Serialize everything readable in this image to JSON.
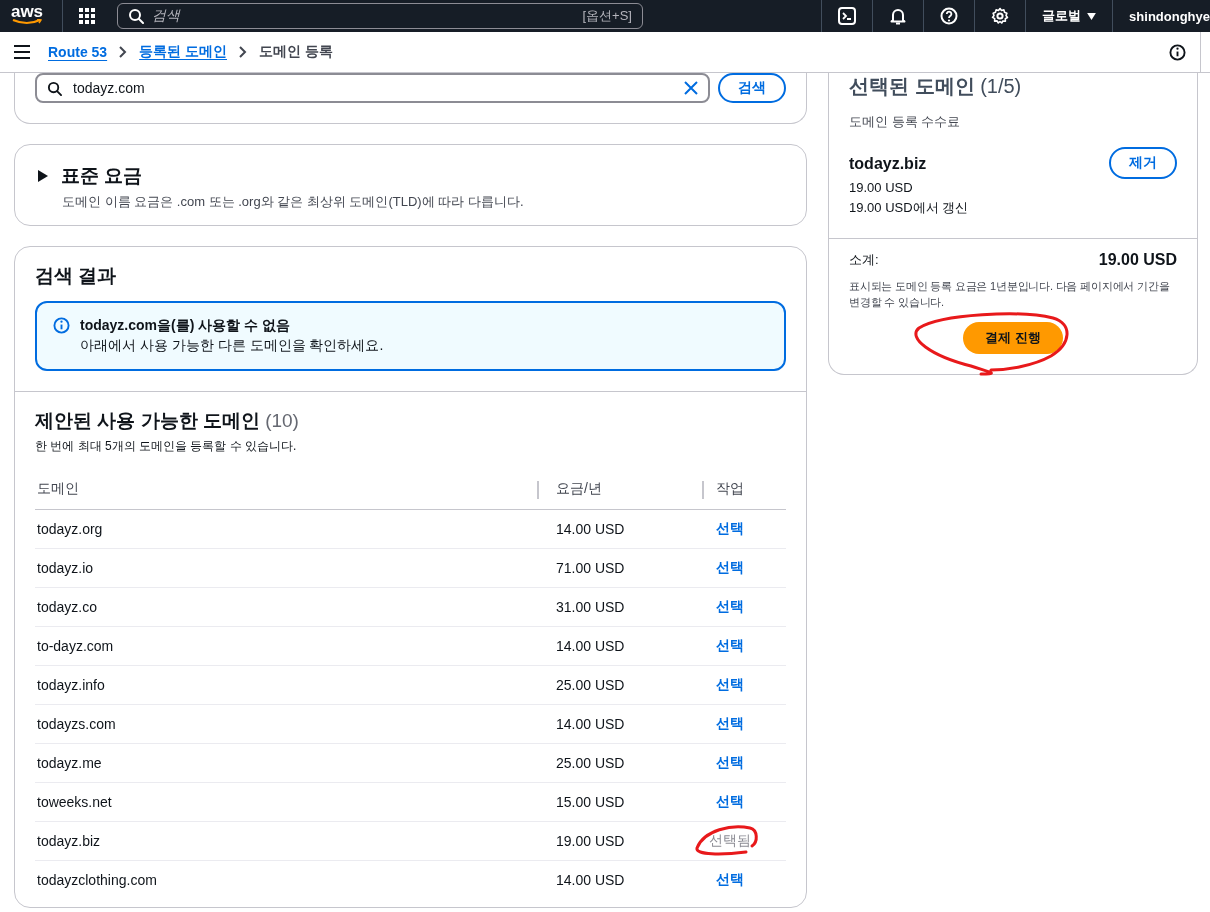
{
  "top_nav": {
    "logo": "aws",
    "search_placeholder": "검색",
    "search_shortcut": "[옵션+S]",
    "region": "글로벌",
    "user": "shindonghye"
  },
  "breadcrumbs": [
    {
      "label": "Route 53",
      "link": true
    },
    {
      "label": "등록된 도메인",
      "link": true
    },
    {
      "label": "도메인 등록",
      "link": false
    }
  ],
  "search": {
    "value": "todayz.com",
    "button": "검색"
  },
  "standard_pricing": {
    "title": "표준 요금",
    "expanded": false,
    "description": "도메인 이름 요금은 .com 또는 .org와 같은 최상위 도메인(TLD)에 따라 다릅니다."
  },
  "results": {
    "title": "검색 결과",
    "alert": {
      "title": "todayz.com을(를) 사용할 수 없음",
      "message": "아래에서 사용 가능한 다른 도메인을 확인하세요."
    },
    "suggested": {
      "title": "제안된 사용 가능한 도메인",
      "count": "(10)",
      "description": "한 번에 최대 5개의 도메인을 등록할 수 있습니다.",
      "columns": [
        "도메인",
        "요금/년",
        "작업"
      ],
      "rows": [
        {
          "domain": "todayz.org",
          "price": "14.00 USD",
          "action": "선택",
          "selected": false
        },
        {
          "domain": "todayz.io",
          "price": "71.00 USD",
          "action": "선택",
          "selected": false
        },
        {
          "domain": "todayz.co",
          "price": "31.00 USD",
          "action": "선택",
          "selected": false
        },
        {
          "domain": "to-dayz.com",
          "price": "14.00 USD",
          "action": "선택",
          "selected": false
        },
        {
          "domain": "todayz.info",
          "price": "25.00 USD",
          "action": "선택",
          "selected": false
        },
        {
          "domain": "todayzs.com",
          "price": "14.00 USD",
          "action": "선택",
          "selected": false
        },
        {
          "domain": "todayz.me",
          "price": "25.00 USD",
          "action": "선택",
          "selected": false
        },
        {
          "domain": "toweeks.net",
          "price": "15.00 USD",
          "action": "선택",
          "selected": false
        },
        {
          "domain": "todayz.biz",
          "price": "19.00 USD",
          "action": "선택됨",
          "selected": true
        },
        {
          "domain": "todayzclothing.com",
          "price": "14.00 USD",
          "action": "선택",
          "selected": false
        }
      ]
    }
  },
  "selected_panel": {
    "title": "선택된 도메인",
    "count": "(1/5)",
    "fee_label": "도메인 등록 수수료",
    "items": [
      {
        "domain": "todayz.biz",
        "price": "19.00 USD",
        "renewal": "19.00 USD에서 갱신",
        "remove": "제거"
      }
    ],
    "subtotal_label": "소계:",
    "subtotal": "19.00 USD",
    "note": "표시되는 도메인 등록 요금은 1년분입니다. 다음 페이지에서 기간을 변경할 수 있습니다.",
    "checkout": "결제 진행"
  }
}
